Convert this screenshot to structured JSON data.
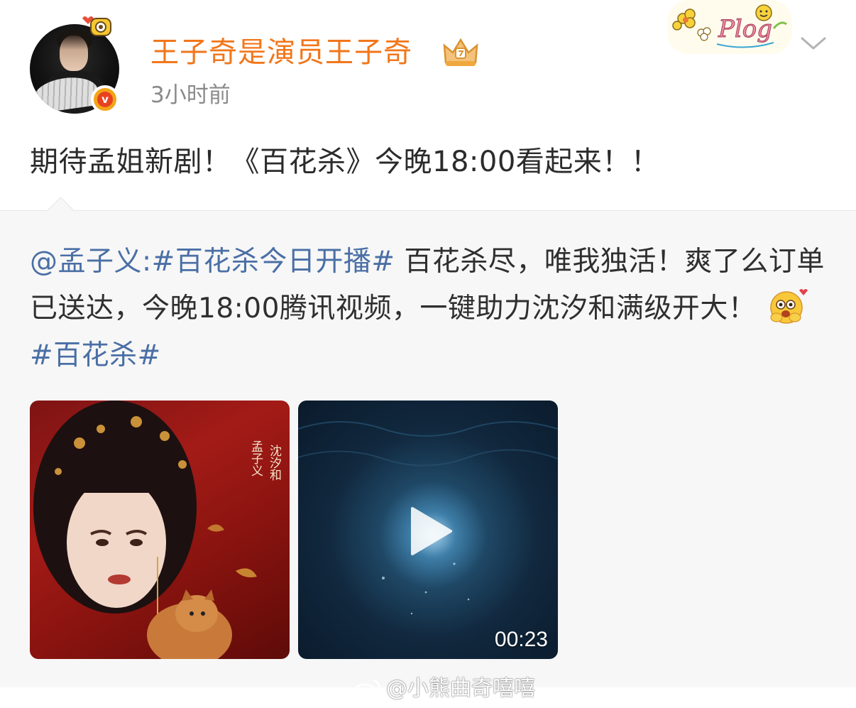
{
  "post": {
    "username": "王子奇是演员王子奇",
    "timestamp": "3小时前",
    "text": "期待孟姐新剧！《百花杀》今晚18:00看起来！！",
    "sticker_text": "Plog",
    "icons": {
      "verified": "verified-v-badge-icon",
      "crown": "crown-member-icon",
      "more": "chevron-down-icon",
      "pet": "pet-camera-icon"
    }
  },
  "repost": {
    "author": "@孟子义:",
    "topic1": "#百花杀今日开播#",
    "text_part1": " 百花杀尽，唯我独活！爽了么订单已送达，今晚18:00腾讯视频，一键助力沈汐和满级开大！",
    "topic2": "#百花杀#",
    "emoji": "excited-face-emoji"
  },
  "media": {
    "poster_caption_right": "沈汐和",
    "poster_caption_left": "孟子义",
    "video_duration": "00:23"
  },
  "watermark": {
    "text": "@小熊曲奇嘻嘻"
  },
  "colors": {
    "username": "#f2761a",
    "link": "#4a6fa5",
    "repost_bg": "#f7f7f7"
  }
}
